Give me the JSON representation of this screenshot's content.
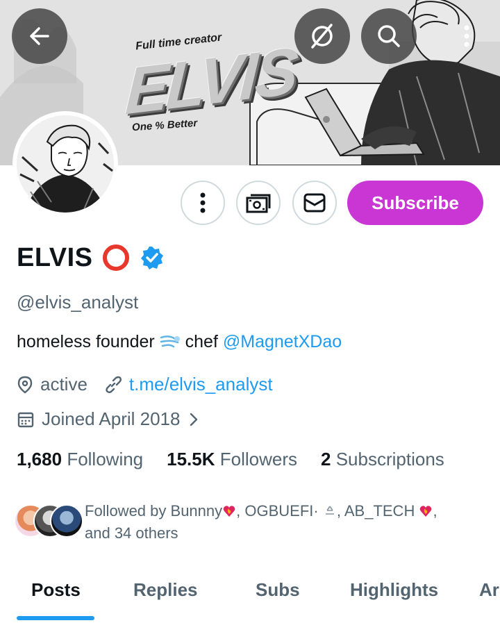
{
  "banner": {
    "tagline_top": "Full time creator",
    "wordmark": "ELVIS",
    "tagline_bottom": "One % Better"
  },
  "top_buttons": {
    "back_icon": "arrow-left-icon",
    "grok_icon": "grok-slash-icon",
    "search_icon": "search-icon",
    "more_icon": "more-vertical-icon"
  },
  "actions": {
    "more_icon": "more-vertical-icon",
    "tip_icon": "money-icon",
    "message_icon": "mail-icon",
    "subscribe_label": "Subscribe",
    "subscribe_color": "#c936d4"
  },
  "profile": {
    "display_name": "ELVIS",
    "name_emoji_icon": "red-circle-icon",
    "verified_icon": "verified-badge-icon",
    "handle": "@elvis_analyst",
    "bio_text": "homeless founder",
    "bio_emoji_icon": "wind-face-icon",
    "bio_text_2": "chef",
    "bio_mention": "@MagnetXDao",
    "location": "active",
    "website": "t.me/elvis_analyst",
    "joined": "Joined April 2018"
  },
  "stats": {
    "following_count": "1,680",
    "following_label": "Following",
    "followers_count": "15.5K",
    "followers_label": "Followers",
    "subscriptions_count": "2",
    "subscriptions_label": "Subscriptions"
  },
  "followed_by": {
    "prefix": "Followed by ",
    "user1": "Bunnny",
    "user2": "OGBUEFI·",
    "user3": "AB_TECH",
    "suffix": "and 34 others"
  },
  "tabs": [
    {
      "label": "Posts",
      "active": true
    },
    {
      "label": "Replies",
      "active": false
    },
    {
      "label": "Subs",
      "active": false
    },
    {
      "label": "Highlights",
      "active": false
    },
    {
      "label": "Ar",
      "active": false
    }
  ],
  "colors": {
    "accent_blue": "#1d9bf0",
    "text_primary": "#0f1419",
    "text_secondary": "#536471",
    "subscribe": "#c936d4"
  }
}
